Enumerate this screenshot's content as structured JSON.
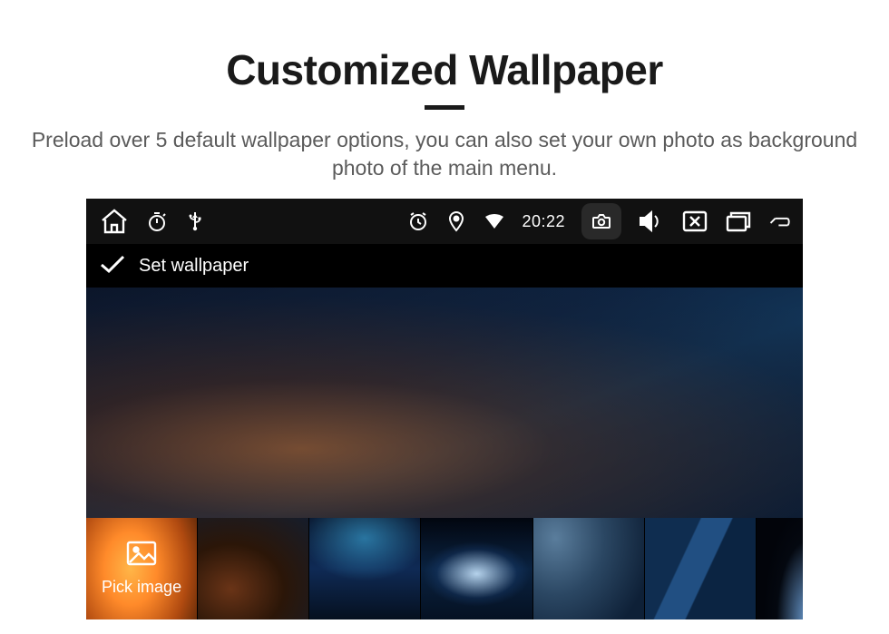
{
  "page": {
    "title": "Customized Wallpaper",
    "subtitle": "Preload over 5 default wallpaper options, you can also set your own photo as background photo of the main menu."
  },
  "statusbar": {
    "time": "20:22"
  },
  "header": {
    "set_wallpaper_label": "Set wallpaper"
  },
  "thumbs": {
    "pick_label": "Pick image"
  }
}
